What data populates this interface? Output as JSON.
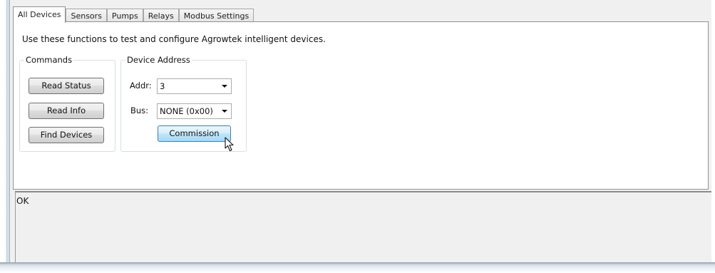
{
  "tabs": [
    {
      "label": "All Devices",
      "active": true
    },
    {
      "label": "Sensors",
      "active": false
    },
    {
      "label": "Pumps",
      "active": false
    },
    {
      "label": "Relays",
      "active": false
    },
    {
      "label": "Modbus Settings",
      "active": false
    }
  ],
  "panel": {
    "hint": "Use these functions to test and configure Agrowtek intelligent devices."
  },
  "commands": {
    "title": "Commands",
    "read_status": "Read Status",
    "read_info": "Read Info",
    "find_devices": "Find Devices"
  },
  "device_address": {
    "title": "Device Address",
    "addr_label": "Addr:",
    "addr_value": "3",
    "bus_label": "Bus:",
    "bus_value": "NONE (0x00)",
    "commission": "Commission"
  },
  "status": {
    "text": "OK"
  },
  "icons": {
    "combo_arrow": "chevron-down-icon",
    "cursor": "mouse-pointer-icon"
  },
  "colors": {
    "commission_accent": "#bee6fd",
    "panel_bg": "#ffffff",
    "window_bg": "#f0f0f0"
  }
}
